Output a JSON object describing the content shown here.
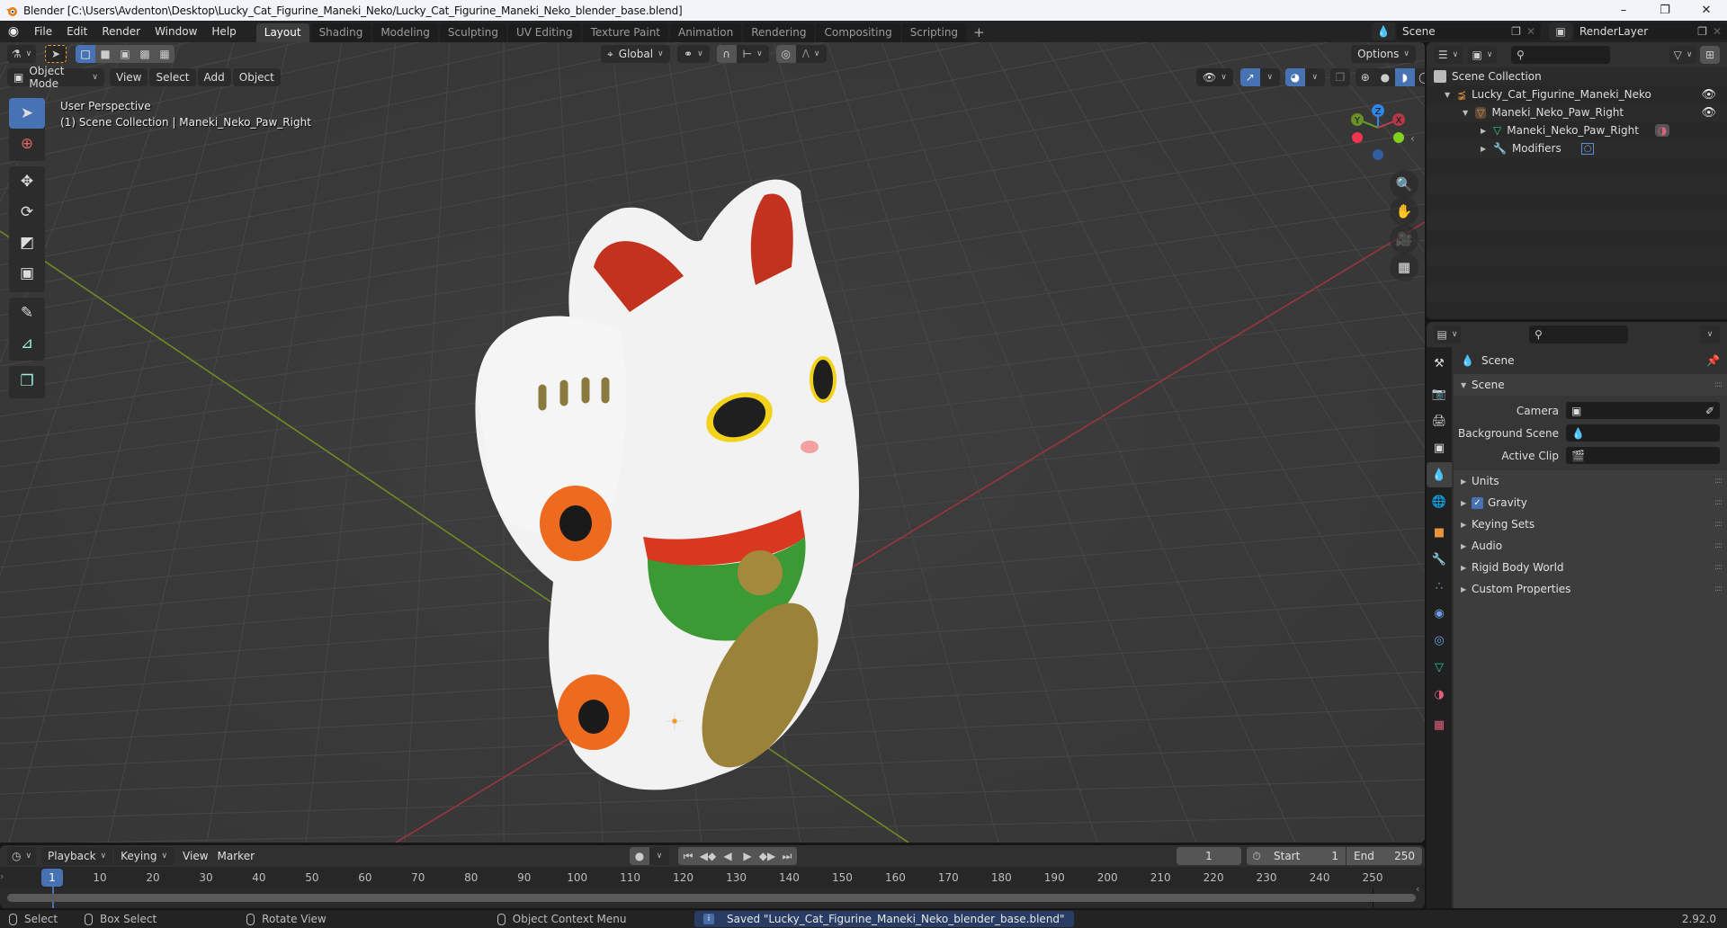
{
  "window": {
    "title": "Blender [C:\\Users\\Avdenton\\Desktop\\Lucky_Cat_Figurine_Maneki_Neko/Lucky_Cat_Figurine_Maneki_Neko_blender_base.blend]",
    "controls": {
      "minimize": "–",
      "maximize": "❐",
      "close": "✕"
    }
  },
  "menubar": {
    "items": [
      "File",
      "Edit",
      "Render",
      "Window",
      "Help"
    ]
  },
  "workspaces": {
    "tabs": [
      "Layout",
      "Shading",
      "Modeling",
      "Sculpting",
      "UV Editing",
      "Texture Paint",
      "Animation",
      "Rendering",
      "Compositing",
      "Scripting"
    ],
    "active": "Layout",
    "add_label": "+"
  },
  "scene_selector": {
    "value": "Scene"
  },
  "view_layer_selector": {
    "value": "RenderLayer"
  },
  "viewport": {
    "header": {
      "transform_orientation": "Global",
      "options_label": "Options",
      "mode": "Object Mode",
      "menus": [
        "View",
        "Select",
        "Add",
        "Object"
      ]
    },
    "overlay_text": {
      "perspective": "User Perspective",
      "context": "(1) Scene Collection | Maneki_Neko_Paw_Right"
    },
    "gizmo_axes": {
      "x": "X",
      "y": "Y",
      "z": "Z"
    },
    "colors": {
      "x_axis": "#c0404a",
      "y_axis": "#6a9a2a",
      "z_axis": "#2f86e6",
      "accent": "#4772b3"
    }
  },
  "outliner": {
    "root": "Scene Collection",
    "rows": [
      {
        "label": "Lucky_Cat_Figurine_Maneki_Neko",
        "icon": "empty-icon",
        "expanded": true,
        "visible": true
      },
      {
        "label": "Maneki_Neko_Paw_Right",
        "icon": "mesh-object-icon",
        "expanded": true,
        "visible": true
      },
      {
        "label": "Maneki_Neko_Paw_Right",
        "icon": "mesh-data-icon",
        "expanded": false
      },
      {
        "label": "Modifiers",
        "icon": "wrench-icon",
        "expanded": false
      }
    ]
  },
  "properties": {
    "context_label": "Scene",
    "panels": {
      "scene": {
        "title": "Scene",
        "fields": [
          {
            "label": "Camera",
            "value": ""
          },
          {
            "label": "Background Scene",
            "value": ""
          },
          {
            "label": "Active Clip",
            "value": ""
          }
        ]
      },
      "collapsed": [
        "Units",
        "Gravity",
        "Keying Sets",
        "Audio",
        "Rigid Body World",
        "Custom Properties"
      ],
      "gravity_checked": true
    },
    "tabs": [
      "tool",
      "render",
      "output",
      "view-layer",
      "scene",
      "world",
      "object",
      "modifiers",
      "particles",
      "physics",
      "constraints",
      "data",
      "material",
      "texture"
    ],
    "active_tab": "scene"
  },
  "timeline": {
    "menus": [
      "Playback",
      "Keying",
      "View",
      "Marker"
    ],
    "current_frame": "1",
    "start_label": "Start",
    "start": "1",
    "end_label": "End",
    "end": "250",
    "ruler_ticks": [
      "10",
      "20",
      "30",
      "40",
      "50",
      "60",
      "70",
      "80",
      "90",
      "100",
      "110",
      "120",
      "130",
      "140",
      "150",
      "160",
      "170",
      "180",
      "190",
      "200",
      "210",
      "220",
      "230",
      "240",
      "250"
    ],
    "playhead_label": "1"
  },
  "statusbar": {
    "hints": [
      {
        "label": "Select"
      },
      {
        "label": "Box Select"
      },
      {
        "label": "Rotate View"
      },
      {
        "label": "Object Context Menu"
      }
    ],
    "message": "Saved \"Lucky_Cat_Figurine_Maneki_Neko_blender_base.blend\"",
    "version": "2.92.0"
  }
}
